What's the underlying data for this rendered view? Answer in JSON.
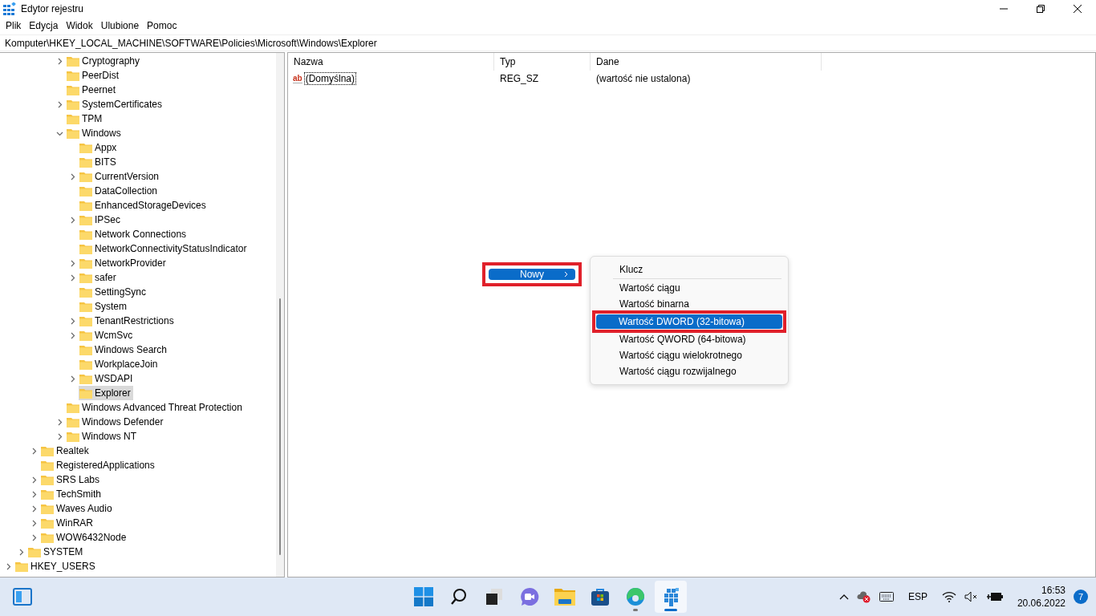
{
  "window": {
    "title": "Edytor rejestru"
  },
  "menu": [
    "Plik",
    "Edycja",
    "Widok",
    "Ulubione",
    "Pomoc"
  ],
  "address": "Komputer\\HKEY_LOCAL_MACHINE\\SOFTWARE\\Policies\\Microsoft\\Windows\\Explorer",
  "tree": [
    {
      "children": [
        {
          "children": [
            {
              "children": [
                {
                  "children": [
                    {
                      "label": "Cryptography",
                      "expandable": true,
                      "selected": false
                    },
                    {
                      "label": "PeerDist",
                      "expandable": false,
                      "selected": false
                    },
                    {
                      "label": "Peernet",
                      "expandable": false,
                      "selected": false
                    },
                    {
                      "label": "SystemCertificates",
                      "expandable": true,
                      "selected": false
                    },
                    {
                      "label": "TPM",
                      "expandable": false,
                      "selected": false
                    },
                    {
                      "label": "Windows",
                      "expandable": true,
                      "selected": false,
                      "children": [
                        {
                          "label": "Appx",
                          "expandable": false,
                          "selected": false
                        },
                        {
                          "label": "BITS",
                          "expandable": false,
                          "selected": false
                        },
                        {
                          "label": "CurrentVersion",
                          "expandable": true,
                          "selected": false
                        },
                        {
                          "label": "DataCollection",
                          "expandable": false,
                          "selected": false
                        },
                        {
                          "label": "EnhancedStorageDevices",
                          "expandable": false,
                          "selected": false
                        },
                        {
                          "label": "IPSec",
                          "expandable": true,
                          "selected": false
                        },
                        {
                          "label": "Network Connections",
                          "expandable": false,
                          "selected": false
                        },
                        {
                          "label": "NetworkConnectivityStatusIndicator",
                          "expandable": false,
                          "selected": false
                        },
                        {
                          "label": "NetworkProvider",
                          "expandable": true,
                          "selected": false
                        },
                        {
                          "label": "safer",
                          "expandable": true,
                          "selected": false
                        },
                        {
                          "label": "SettingSync",
                          "expandable": false,
                          "selected": false
                        },
                        {
                          "label": "System",
                          "expandable": false,
                          "selected": false
                        },
                        {
                          "label": "TenantRestrictions",
                          "expandable": true,
                          "selected": false
                        },
                        {
                          "label": "WcmSvc",
                          "expandable": true,
                          "selected": false
                        },
                        {
                          "label": "Windows Search",
                          "expandable": false,
                          "selected": false
                        },
                        {
                          "label": "WorkplaceJoin",
                          "expandable": false,
                          "selected": false
                        },
                        {
                          "label": "WSDAPI",
                          "expandable": true,
                          "selected": false
                        },
                        {
                          "label": "Explorer",
                          "expandable": false,
                          "selected": true
                        }
                      ]
                    },
                    {
                      "label": "Windows Advanced Threat Protection",
                      "expandable": false,
                      "selected": false
                    },
                    {
                      "label": "Windows Defender",
                      "expandable": true,
                      "selected": false
                    },
                    {
                      "label": "Windows NT",
                      "expandable": true,
                      "selected": false
                    }
                  ]
                }
              ]
            },
            {
              "label": "Realtek",
              "expandable": true,
              "selected": false
            },
            {
              "label": "RegisteredApplications",
              "expandable": false,
              "selected": false
            },
            {
              "label": "SRS Labs",
              "expandable": true,
              "selected": false
            },
            {
              "label": "TechSmith",
              "expandable": true,
              "selected": false
            },
            {
              "label": "Waves Audio",
              "expandable": true,
              "selected": false
            },
            {
              "label": "WinRAR",
              "expandable": true,
              "selected": false
            },
            {
              "label": "WOW6432Node",
              "expandable": true,
              "selected": false
            }
          ]
        },
        {
          "label": "SYSTEM",
          "expandable": true,
          "selected": false
        }
      ]
    },
    {
      "label": "HKEY_USERS",
      "expandable": true,
      "selected": false
    }
  ],
  "table": {
    "columns": [
      "Nazwa",
      "Typ",
      "Dane"
    ],
    "rows": [
      {
        "icon_text": "ab",
        "name": "(Domyślna)",
        "type": "REG_SZ",
        "data": "(wartość nie ustalona)",
        "focused": true
      }
    ]
  },
  "context_menu": {
    "items": [
      {
        "label": "Nowy",
        "selected": true,
        "highlighted": true
      }
    ]
  },
  "submenu": {
    "items": [
      {
        "label": "Klucz",
        "selected": false,
        "highlighted": false,
        "separator_after": true
      },
      {
        "label": "Wartość ciągu",
        "selected": false,
        "highlighted": false,
        "separator_after": false
      },
      {
        "label": "Wartość binarna",
        "selected": false,
        "highlighted": false,
        "separator_after": false
      },
      {
        "label": "Wartość DWORD (32-bitowa)",
        "selected": true,
        "highlighted": true,
        "separator_after": false
      },
      {
        "label": "Wartość QWORD (64-bitowa)",
        "selected": false,
        "highlighted": false,
        "separator_after": false
      },
      {
        "label": "Wartość ciągu wielokrotnego",
        "selected": false,
        "highlighted": false,
        "separator_after": false
      },
      {
        "label": "Wartość ciągu rozwijalnego",
        "selected": false,
        "highlighted": false,
        "separator_after": false
      }
    ]
  },
  "taskbar": {
    "apps": [
      {
        "kind": "start",
        "running": false,
        "active": false
      },
      {
        "kind": "search",
        "running": false,
        "active": false
      },
      {
        "kind": "taskview",
        "running": false,
        "active": false
      },
      {
        "kind": "chat",
        "running": false,
        "active": false
      },
      {
        "kind": "files",
        "running": false,
        "active": false
      },
      {
        "kind": "store",
        "running": false,
        "active": false
      },
      {
        "kind": "edge",
        "running": true,
        "active": false
      },
      {
        "kind": "registry",
        "running": true,
        "active": true
      }
    ],
    "language": "ESP",
    "time": "16:53",
    "date": "20.06.2022",
    "notifications": "7"
  }
}
